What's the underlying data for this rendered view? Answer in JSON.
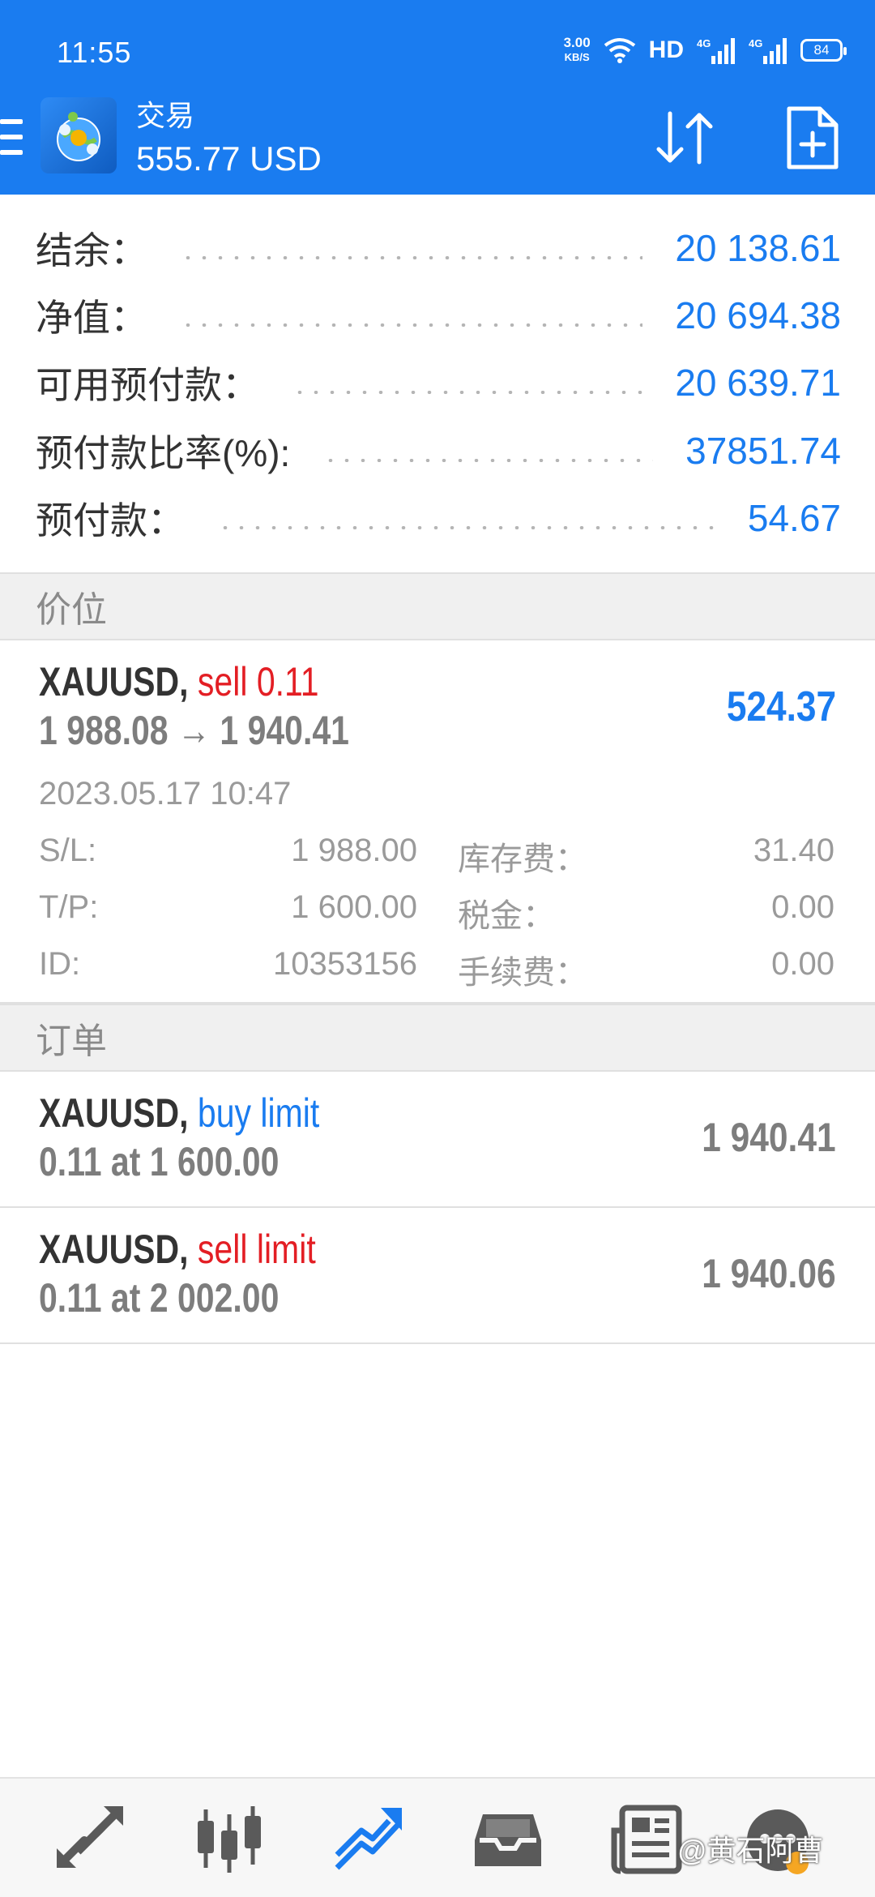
{
  "status_bar": {
    "time": "11:55",
    "net_speed": "3.00",
    "net_unit": "KB/S",
    "hd": "HD",
    "signal1": "4G",
    "signal2": "4G",
    "battery": "84"
  },
  "header": {
    "title": "交易",
    "balance_line": "555.77 USD"
  },
  "summary": {
    "rows": [
      {
        "label": "结余：",
        "value": "20 138.61"
      },
      {
        "label": "净值：",
        "value": "20 694.38"
      },
      {
        "label": "可用预付款：",
        "value": "20 639.71"
      },
      {
        "label": "预付款比率(%):",
        "value": "37851.74"
      },
      {
        "label": "预付款：",
        "value": "54.67"
      }
    ]
  },
  "sections": {
    "positions": "价位",
    "orders": "订单"
  },
  "position": {
    "symbol": "XAUUSD,",
    "side": "sell 0.11",
    "prices": "1 988.08 → 1 940.41",
    "profit": "524.37",
    "datetime": "2023.05.17 10:47",
    "sl_label": "S/L:",
    "sl_value": "1 988.00",
    "tp_label": "T/P:",
    "tp_value": "1 600.00",
    "id_label": "ID:",
    "id_value": "10353156",
    "swap_label": "库存费：",
    "swap_value": "31.40",
    "tax_label": "税金：",
    "tax_value": "0.00",
    "fee_label": "手续费：",
    "fee_value": "0.00"
  },
  "orders": [
    {
      "symbol": "XAUUSD,",
      "type": "buy limit",
      "detail": "0.11 at 1 600.00",
      "price": "1 940.41"
    },
    {
      "symbol": "XAUUSD,",
      "type": "sell limit",
      "detail": "0.11 at 2 002.00",
      "price": "1 940.06"
    }
  ],
  "bottom_nav": {
    "items": [
      "quotes-icon",
      "chart-icon",
      "trade-icon",
      "history-icon",
      "news-icon",
      "community-icon"
    ],
    "active": "trade-icon",
    "accent": "#1a7cf0"
  },
  "watermark": "@黄石阿曹",
  "colors": {
    "brand": "#1a7cf0",
    "sell": "#e31e24",
    "buy": "#1a7cf0"
  }
}
